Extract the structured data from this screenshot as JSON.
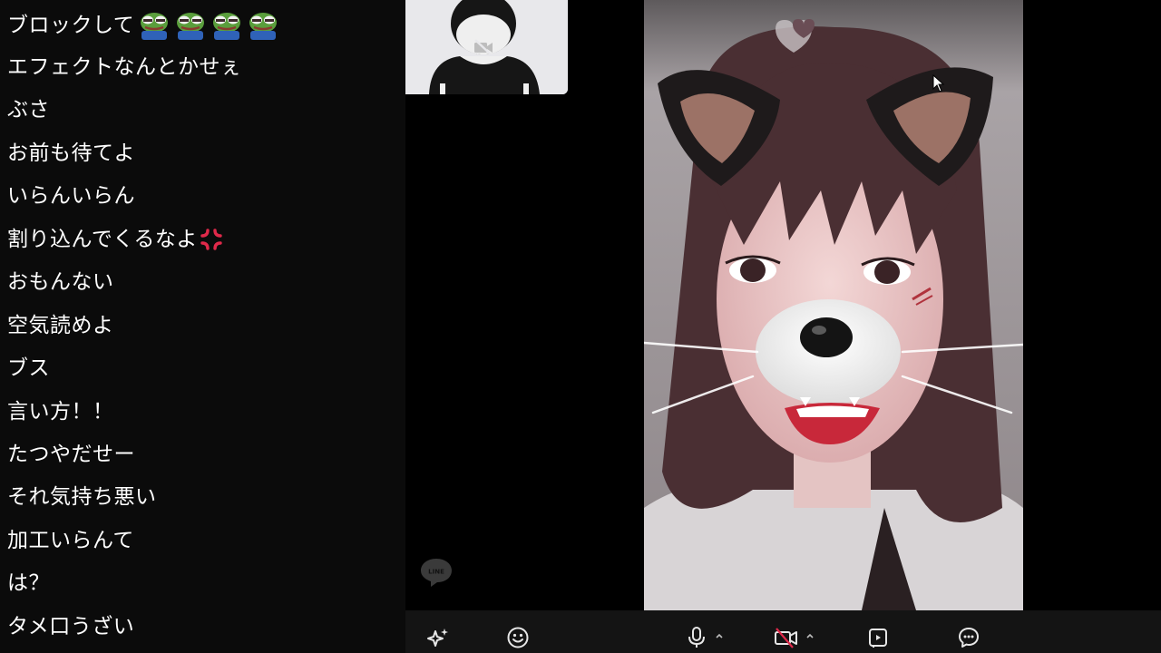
{
  "chat": {
    "messages": [
      {
        "text": "ブロックして"
      },
      {
        "text": "エフェクトなんとかせぇ"
      },
      {
        "text": "ぶさ"
      },
      {
        "text": "お前も待てよ"
      },
      {
        "text": "いらんいらん"
      },
      {
        "text": "割り込んでくるなよ"
      },
      {
        "text": "おもんない"
      },
      {
        "text": "空気読めよ"
      },
      {
        "text": "ブス"
      },
      {
        "text": "言い方！！"
      },
      {
        "text": "たつやだせー"
      },
      {
        "text": "それ気持ち悪い"
      },
      {
        "text": "加工いらんて"
      },
      {
        "text": "は？"
      },
      {
        "text": "タメ口うざい"
      }
    ],
    "first_message_emoji": [
      "pepe-frog-emoji",
      "pepe-frog-emoji",
      "pepe-frog-emoji",
      "pepe-frog-emoji"
    ],
    "sixth_message_emoji": "anger-symbol-emoji",
    "text_color": "#ffffff",
    "background_color": "#0b0b0b"
  },
  "video": {
    "self_view_icons": [
      "user-silhouette-icon",
      "camera-off-icon"
    ],
    "watermark": {
      "icon": "line-logo-icon",
      "text": "LINE"
    },
    "remote_view_effect": "cat-ears-filter",
    "cursor_icon": "mouse-pointer-icon"
  },
  "toolbar": {
    "buttons": [
      {
        "name": "effects-button",
        "icon": "sparkle-icon"
      },
      {
        "name": "emoji-button",
        "icon": "smiley-icon"
      },
      {
        "name": "microphone-button",
        "icon": "microphone-icon"
      },
      {
        "name": "microphone-options",
        "icon": "chevron-up-icon"
      },
      {
        "name": "camera-toggle-button",
        "icon": "camera-off-icon",
        "state": "off"
      },
      {
        "name": "camera-options",
        "icon": "chevron-up-icon"
      },
      {
        "name": "share-screen-button",
        "icon": "share-screen-icon"
      },
      {
        "name": "chat-button",
        "icon": "chat-bubble-icon"
      }
    ],
    "background_color": "#141414",
    "icon_color": "#e6e6e6",
    "alert_color": "#e0294a"
  }
}
